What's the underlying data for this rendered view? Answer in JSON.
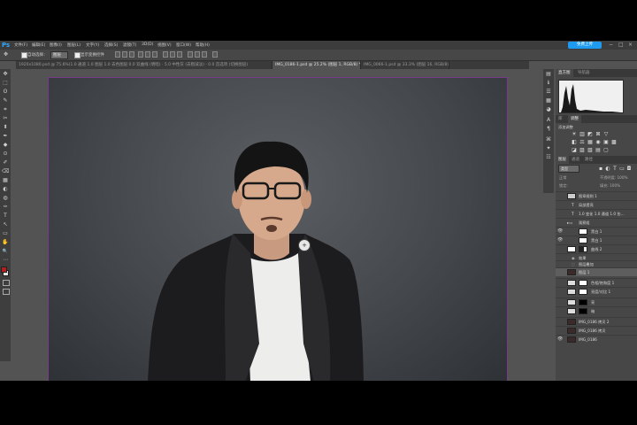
{
  "app": {
    "logo": "Ps",
    "share_label": "免费上传"
  },
  "menu": [
    "文件(F)",
    "编辑(E)",
    "图像(I)",
    "图层(L)",
    "文字(Y)",
    "选择(S)",
    "滤镜(T)",
    "3D(D)",
    "视图(V)",
    "窗口(W)",
    "帮助(H)"
  ],
  "window_controls": [
    "−",
    "□",
    "×"
  ],
  "options": {
    "auto_select_label": "自动选择：",
    "auto_select_value": "图层",
    "show_transform_label": "显示变换控件"
  },
  "tabs": [
    {
      "label": "1920x1080.psd @ 75.6%(1.0 通道 1.0 图层 1.0 去色图层 0.0 双曲线 (明暗) · 5.0 中性灰 (去粗减淡) · 0.0 首选项 (切换图层)",
      "active": false
    },
    {
      "label": "IMG_0186-1.psd @ 25.2% (图层 1, RGB/8) *",
      "active": true
    },
    {
      "label": "IMG_0066-1.psd @ 33.3% (图层 16, RGB/8) *",
      "active": false
    }
  ],
  "tools": [
    "✥",
    "⬚",
    "ʘ",
    "✎",
    "⌗",
    "✂",
    "⬍",
    "✒",
    "◆",
    "⊙",
    "✐",
    "⌫",
    "▦",
    "◐",
    "◍",
    "✑",
    "T",
    "↖",
    "▭",
    "✋",
    "🔍",
    "⋯"
  ],
  "mini_tools": [
    "▤",
    "ℹ",
    "☰",
    "▦",
    "◕",
    "A",
    "¶",
    "⌘",
    "✦",
    "☷"
  ],
  "panels": {
    "top_tabs": [
      "直方图",
      "导航器"
    ],
    "adjust_tabs": [
      "库",
      "调整"
    ],
    "adjust_heading": "添加调整",
    "adjust_icons_row1": [
      "☀",
      "▥",
      "◩",
      "⊠",
      "▽"
    ],
    "adjust_icons_row2": [
      "◧",
      "⚖",
      "▦",
      "◉",
      "▣",
      "▩"
    ],
    "adjust_icons_row3": [
      "◪",
      "▨",
      "▧",
      "▤",
      "▢"
    ],
    "layers_tabs": [
      "图层",
      "通道",
      "路径"
    ],
    "filter_label": "类型",
    "blend_mode": "正常",
    "opacity_label": "不透明度: 100%",
    "lock_label": "锁定:",
    "fill_label": "填充: 100%"
  },
  "layers": [
    {
      "name": "图章规则 1",
      "type": "adj",
      "selected": false
    },
    {
      "name": "局部提亮",
      "type": "text",
      "selected": false
    },
    {
      "name": "1.0 变化 1.0 通道 1.0 伤…",
      "type": "text",
      "selected": false
    },
    {
      "name": "观察组",
      "type": "folder",
      "selected": false
    },
    {
      "name": "黑白 1",
      "type": "adj",
      "selected": false
    },
    {
      "name": "黑白 1",
      "type": "adj",
      "selected": false
    },
    {
      "name": "曲线 2",
      "type": "curve",
      "selected": false
    },
    {
      "name": "效果",
      "type": "fx",
      "selected": false
    },
    {
      "name": "图层叠加",
      "type": "fx",
      "selected": false
    },
    {
      "name": "图层 1",
      "type": "photo",
      "selected": true
    },
    {
      "name": "色相/饱和度 1",
      "type": "adj",
      "selected": false
    },
    {
      "name": "亮度/对比 1",
      "type": "adj",
      "selected": false
    },
    {
      "name": "亮",
      "type": "black",
      "selected": false
    },
    {
      "name": "暗",
      "type": "black",
      "selected": false
    },
    {
      "name": "IMG_0186 拷贝 2",
      "type": "photo",
      "selected": false
    },
    {
      "name": "IMG_0186 拷贝",
      "type": "photo",
      "selected": false
    },
    {
      "name": "IMG_0186",
      "type": "photo",
      "selected": false
    }
  ]
}
